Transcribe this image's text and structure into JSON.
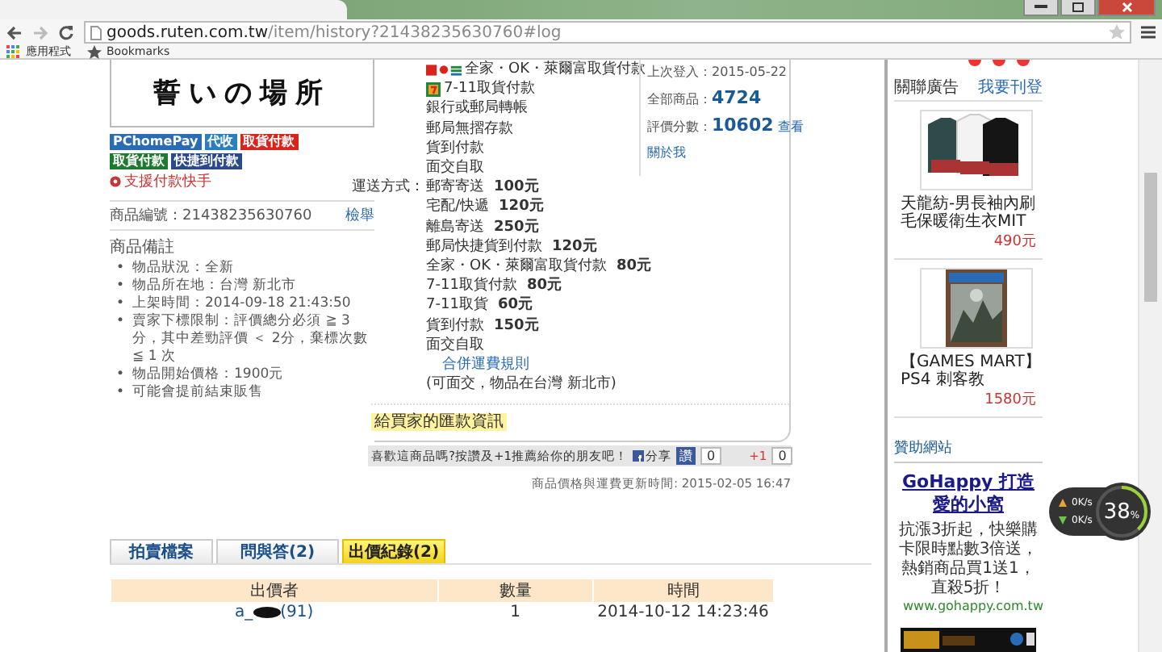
{
  "browser": {
    "url_host": "goods.ruten.com.tw",
    "url_path": "/item/history?21438235630760#log",
    "bookmarks": [
      {
        "kind": "apps",
        "label": "應用程式"
      },
      {
        "kind": "star",
        "label": "Bookmarks"
      }
    ]
  },
  "listing": {
    "cover_text": "誓いの場所",
    "pay_badges": [
      {
        "label": "PChomePay",
        "color": "#2a6bb5"
      },
      {
        "label": "代收",
        "color": "#2a7fc0"
      },
      {
        "label": "取貨付款",
        "color": "#d9241c"
      },
      {
        "label": "取貨付款",
        "color": "#1e7a2e"
      },
      {
        "label": "快捷到付款",
        "color": "#2b4a8a"
      }
    ],
    "support_link": "支援付款快手",
    "item_number": "商品編號：21438235630760",
    "report_link": "檢舉",
    "notes_title": "商品備註",
    "notes": [
      {
        "bullet": "•",
        "text": "物品狀況：全新"
      },
      {
        "bullet": "•",
        "text": "物品所在地：台灣 新北市"
      },
      {
        "bullet": "•",
        "text": "上架時間：2014-09-18 21:43:50"
      },
      {
        "bullet": "•",
        "text": "賣家下標限制：評價總分必須 ≧ 3分，其中差勁評價 ＜ 2分，棄標次數 ≦ 1 次"
      },
      {
        "bullet": "•",
        "text": "物品開始價格：1900元"
      },
      {
        "bullet": "•",
        "text": "可能會提前結束販售"
      }
    ]
  },
  "payment": {
    "methods": [
      {
        "kind": "convenience",
        "label": "全家・OK・萊爾富取貨付款"
      },
      {
        "kind": "seven",
        "label": "7-11取貨付款"
      },
      {
        "kind": "plain",
        "label": "銀行或郵局轉帳"
      },
      {
        "kind": "plain",
        "label": "郵局無摺存款"
      },
      {
        "kind": "plain",
        "label": "貨到付款"
      },
      {
        "kind": "plain",
        "label": "面交自取"
      }
    ],
    "shipping_label": "運送方式：",
    "shipping": [
      {
        "method": "郵寄寄送",
        "price": "100元"
      },
      {
        "method": "宅配/快遞",
        "price": "120元"
      },
      {
        "method": "離島寄送",
        "price": "250元"
      },
      {
        "method": "郵局快捷貨到付款",
        "price": "120元"
      },
      {
        "method": "全家・OK・萊爾富取貨付款",
        "price": "80元"
      },
      {
        "method": "7-11取貨付款",
        "price": "80元"
      },
      {
        "method": "7-11取貨",
        "price": "60元"
      },
      {
        "method": "貨到付款",
        "price": "150元"
      },
      {
        "method": "面交自取"
      }
    ],
    "rules_link": "合併運費規則",
    "pickup_note": "(可面交，物品在台灣 新北市)",
    "remit_info": "給買家的匯款資訊"
  },
  "seller": {
    "last_login": "上次登入：2015-05-22",
    "stats": [
      {
        "label": "全部商品：",
        "value": "4724"
      },
      {
        "label": "評價分數：",
        "value": "10602",
        "link": "查看"
      }
    ],
    "about_link": "關於我"
  },
  "share": {
    "prompt": "喜歡這商品嗎?按讚及+1推薦給你的朋友吧！",
    "share_label": "分享",
    "like_label": "讚",
    "like_count": "0",
    "plus_label": "+1",
    "plus_count": "0"
  },
  "updated": "商品價格與運費更新時間: 2015-02-05  16:47",
  "tabs": [
    {
      "label": "拍賣檔案",
      "selected": false
    },
    {
      "label": "問與答(2)",
      "selected": false
    },
    {
      "label": "出價紀錄(2)",
      "selected": true
    }
  ],
  "bids": {
    "columns": [
      "出價者",
      "數量",
      "時間"
    ],
    "rows": [
      {
        "bidder_prefix": "a_",
        "bidder_suffix": "(91)",
        "quantity": "1",
        "time": "2014-10-12 14:23:46"
      }
    ]
  },
  "ads": {
    "title": "關聯廣告",
    "post_link": "我要刊登",
    "products": [
      {
        "kind": "picture",
        "name": "天龍紡-男長袖內刷毛保暖衛生衣MIT",
        "price": "490元"
      },
      {
        "kind": "picture",
        "name": "【GAMES MART】PS4 刺客教",
        "price": "1580元"
      }
    ],
    "sponsor_title": "贊助網站",
    "sponsor": {
      "headline": "GoHappy 打造愛的小窩",
      "body": "抗漲3折起，快樂購卡限時點數3倍送，熱銷商品買1送1，直殺5折！",
      "url": "www.gohappy.com.tw"
    }
  },
  "widget": {
    "up": "0K/s",
    "down": "0K/s",
    "percent": "38",
    "unit": "%",
    "level": 0.38
  }
}
